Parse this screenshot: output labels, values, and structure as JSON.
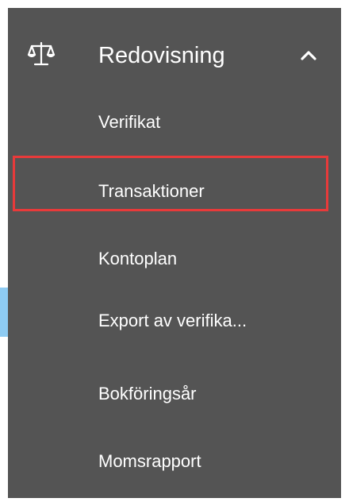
{
  "colors": {
    "panel_bg": "#545454",
    "text": "#ffffff",
    "highlight": "#e83a3a",
    "active_indicator": "#8ecbf2"
  },
  "section": {
    "title": "Redovisning",
    "icon": "scales-icon",
    "expanded_icon": "chevron-up-icon"
  },
  "items": [
    {
      "label": "Verifikat"
    },
    {
      "label": "Transaktioner"
    },
    {
      "label": "Kontoplan"
    },
    {
      "label": "Export av verifika..."
    },
    {
      "label": "Bokföringsår"
    },
    {
      "label": "Momsrapport"
    }
  ]
}
